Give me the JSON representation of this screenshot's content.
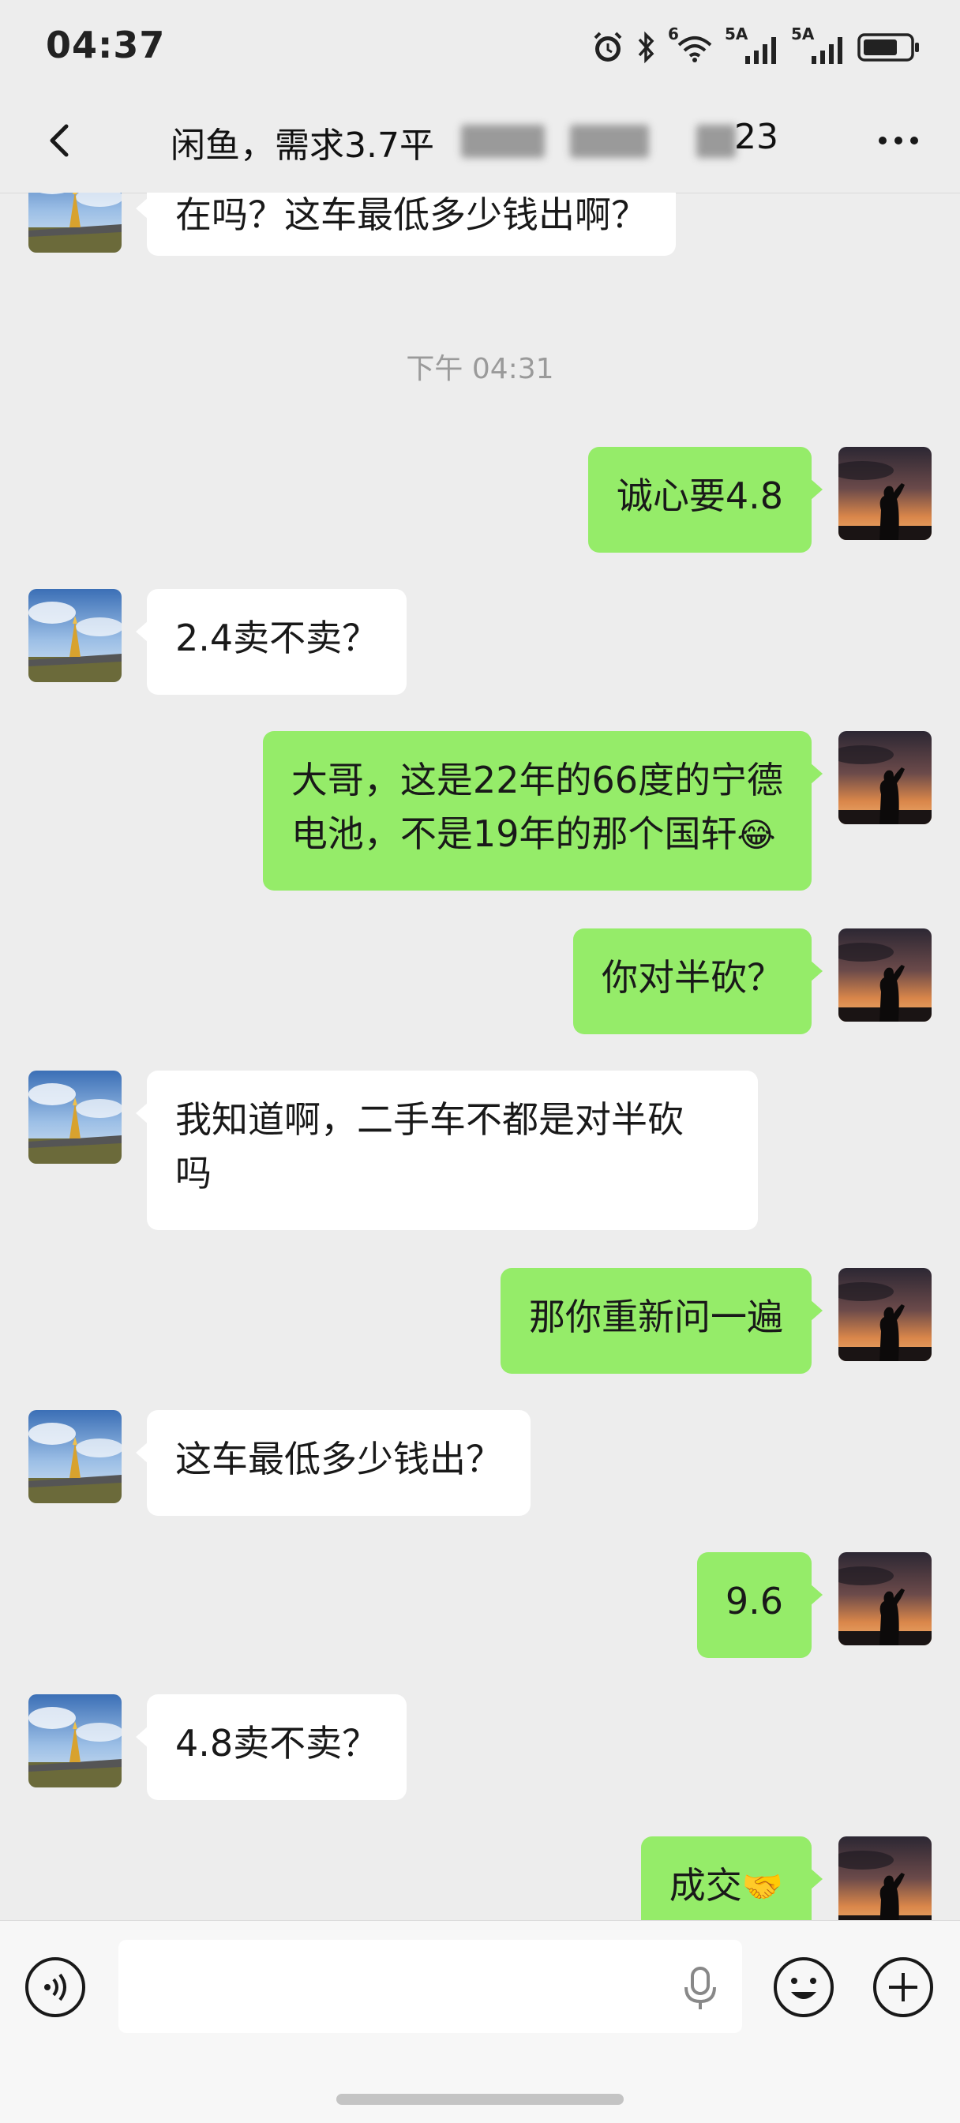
{
  "status_bar": {
    "time": "04:37",
    "net1": "5A",
    "net2": "5A",
    "wifi_tag": "6",
    "icons": [
      "alarm-icon",
      "bluetooth-icon",
      "wifi-icon",
      "signal-icon",
      "signal-icon",
      "battery-icon"
    ]
  },
  "header": {
    "title_visible": "闲鱼，需求3.7平",
    "title_tail": "23",
    "back_icon": "back-arrow-icon",
    "more_icon": "more-icon"
  },
  "timestamp": "下午 04:31",
  "messages": [
    {
      "side": "in",
      "text": "在吗？这车最低多少钱出啊？"
    },
    {
      "side": "out",
      "text": "诚心要4.8"
    },
    {
      "side": "in",
      "text": "2.4卖不卖？"
    },
    {
      "side": "out",
      "line1": "大哥，这是22年的66度的宁德",
      "line2": "电池，不是19年的那个国轩",
      "emoji": "😂"
    },
    {
      "side": "out",
      "text": "你对半砍？"
    },
    {
      "side": "in",
      "line1": "我知道啊，二手车不都是对半砍",
      "line2": "吗"
    },
    {
      "side": "out",
      "text": "那你重新问一遍"
    },
    {
      "side": "in",
      "text": "这车最低多少钱出？"
    },
    {
      "side": "out",
      "text": "9.6"
    },
    {
      "side": "in",
      "text": "4.8卖不卖？"
    },
    {
      "side": "out",
      "text": "成交",
      "emoji": "🤝"
    }
  ],
  "input_bar": {
    "placeholder": "",
    "voice_icon": "voice-icon",
    "mic_icon": "microphone-icon",
    "emoji_icon": "emoji-icon",
    "plus_icon": "plus-icon"
  },
  "colors": {
    "background": "#ededed",
    "incoming_bubble": "#ffffff",
    "outgoing_bubble": "#95ec69",
    "timestamp": "#9a9a9a"
  }
}
